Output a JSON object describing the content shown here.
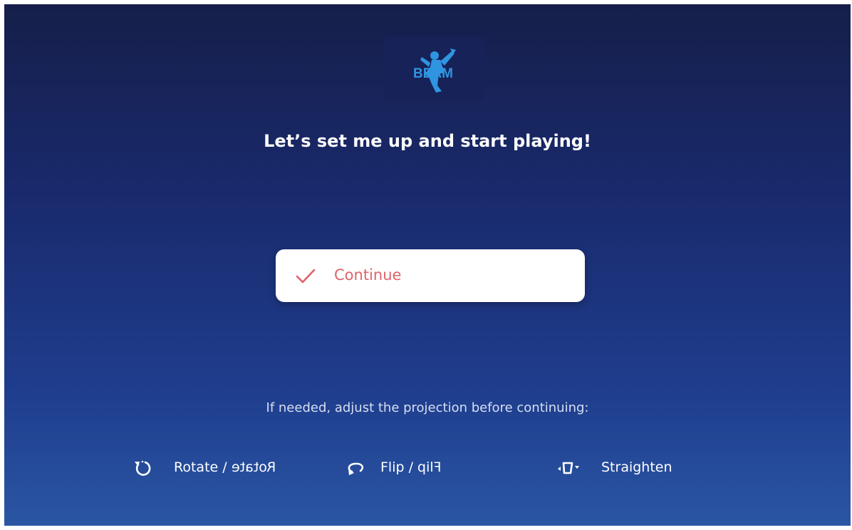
{
  "logo": {
    "text": "BEAM",
    "icon": "beam-figure-logo-icon"
  },
  "headline": "Let’s set me up and start playing!",
  "continue_button": {
    "label": "Continue",
    "icon": "checkmark-icon",
    "label_color": "#e0626a"
  },
  "hint": "If needed, adjust the projection before continuing:",
  "controls": {
    "rotate": {
      "label": "Rotate",
      "separator": "/",
      "mirrored_label": "Rotate",
      "icon": "rotate-icon"
    },
    "flip": {
      "label": "Flip",
      "separator": "/",
      "mirrored_label": "Flip",
      "icon": "flip-icon"
    },
    "straighten": {
      "label": "Straighten",
      "icon": "straighten-icon"
    }
  },
  "colors": {
    "background_top": "#161f4a",
    "background_bottom": "#2a56a4",
    "logo_blue": "#2f95e0",
    "accent_red": "#e0626a"
  }
}
